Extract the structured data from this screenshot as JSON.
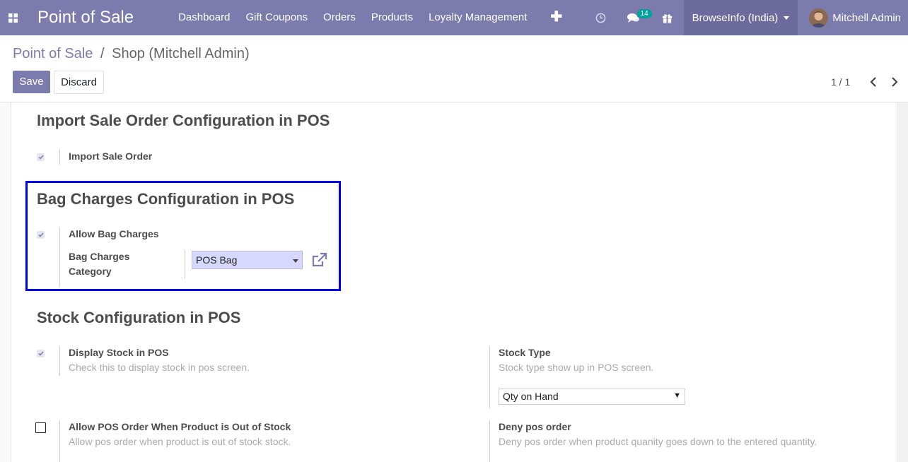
{
  "navbar": {
    "app_title": "Point of Sale",
    "menu": [
      "Dashboard",
      "Gift Coupons",
      "Orders",
      "Products",
      "Loyalty Management"
    ],
    "plus": "✚",
    "chat_badge": "14",
    "company": "BrowseInfo (India)",
    "user": "Mitchell Admin",
    "accent_color": "#7c7bad"
  },
  "breadcrumb": {
    "parent": "Point of Sale",
    "separator": "/",
    "current": "Shop (Mitchell Admin)"
  },
  "buttons": {
    "save": "Save",
    "discard": "Discard"
  },
  "pager": {
    "text": "1 / 1"
  },
  "sections": {
    "import": {
      "title": "Import Sale Order Configuration in POS",
      "field_label": "Import Sale Order",
      "checked": true
    },
    "bag": {
      "title": "Bag Charges Configuration in POS",
      "allow_label": "Allow Bag Charges",
      "allow_checked": true,
      "category_label_line1": "Bag Charges",
      "category_label_line2": "Category",
      "category_value": "POS Bag",
      "highlight_color": "#0000e6"
    },
    "stock": {
      "title": "Stock Configuration in POS",
      "display_label": "Display Stock in POS",
      "display_help": "Check this to display stock in pos screen.",
      "display_checked": true,
      "stock_type_label": "Stock Type",
      "stock_type_help": "Stock type show up in POS screen.",
      "stock_type_value": "Qty on Hand",
      "allow_oos_label": "Allow POS Order When Product is Out of Stock",
      "allow_oos_help": "Allow pos order when product is out of stock stock.",
      "allow_oos_checked": false,
      "deny_label": "Deny pos order",
      "deny_help": "Deny pos order when product quanity goes down to the entered quantity."
    }
  }
}
